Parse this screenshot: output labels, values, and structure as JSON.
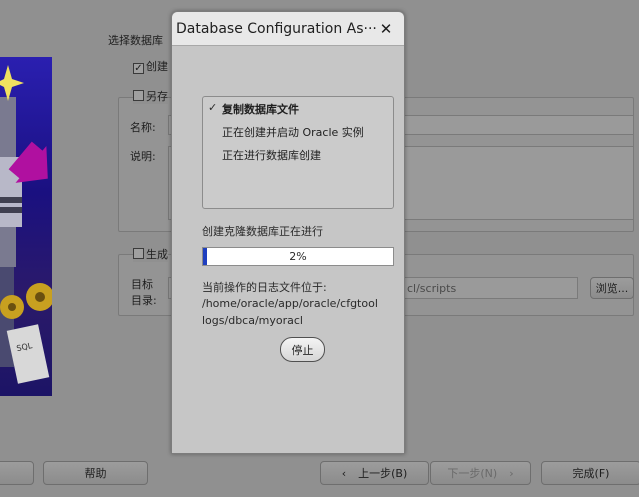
{
  "background": {
    "select_label": "选择数据库",
    "create_label": "创建",
    "saveas_label": "另存",
    "name_label": "名称:",
    "desc_label": "说明:",
    "generate_label": "生成",
    "target_label": "目标",
    "dir_label": "目录:",
    "path_value": "cl/scripts",
    "browse_label": "浏览...",
    "help_label": "帮助",
    "back_label": "上一步(B)",
    "next_label": "下一步(N)",
    "finish_label": "完成(F)"
  },
  "dialog": {
    "title": "Database Configuration As···",
    "close_glyph": "✕",
    "steps": [
      {
        "mark": "✓",
        "label": "复制数据库文件"
      },
      {
        "mark": "",
        "label": "正在创建并启动 Oracle 实例"
      },
      {
        "mark": "",
        "label": "正在进行数据库创建"
      }
    ],
    "status": "创建克隆数据库正在进行",
    "progress_text": "2%",
    "progress_value": 0.02,
    "log_label": "当前操作的日志文件位于:",
    "log_lines": [
      "/home/oracle/app/oracle/cfgtool",
      "logs/dbca/myoracl"
    ],
    "stop_label": "停止"
  }
}
